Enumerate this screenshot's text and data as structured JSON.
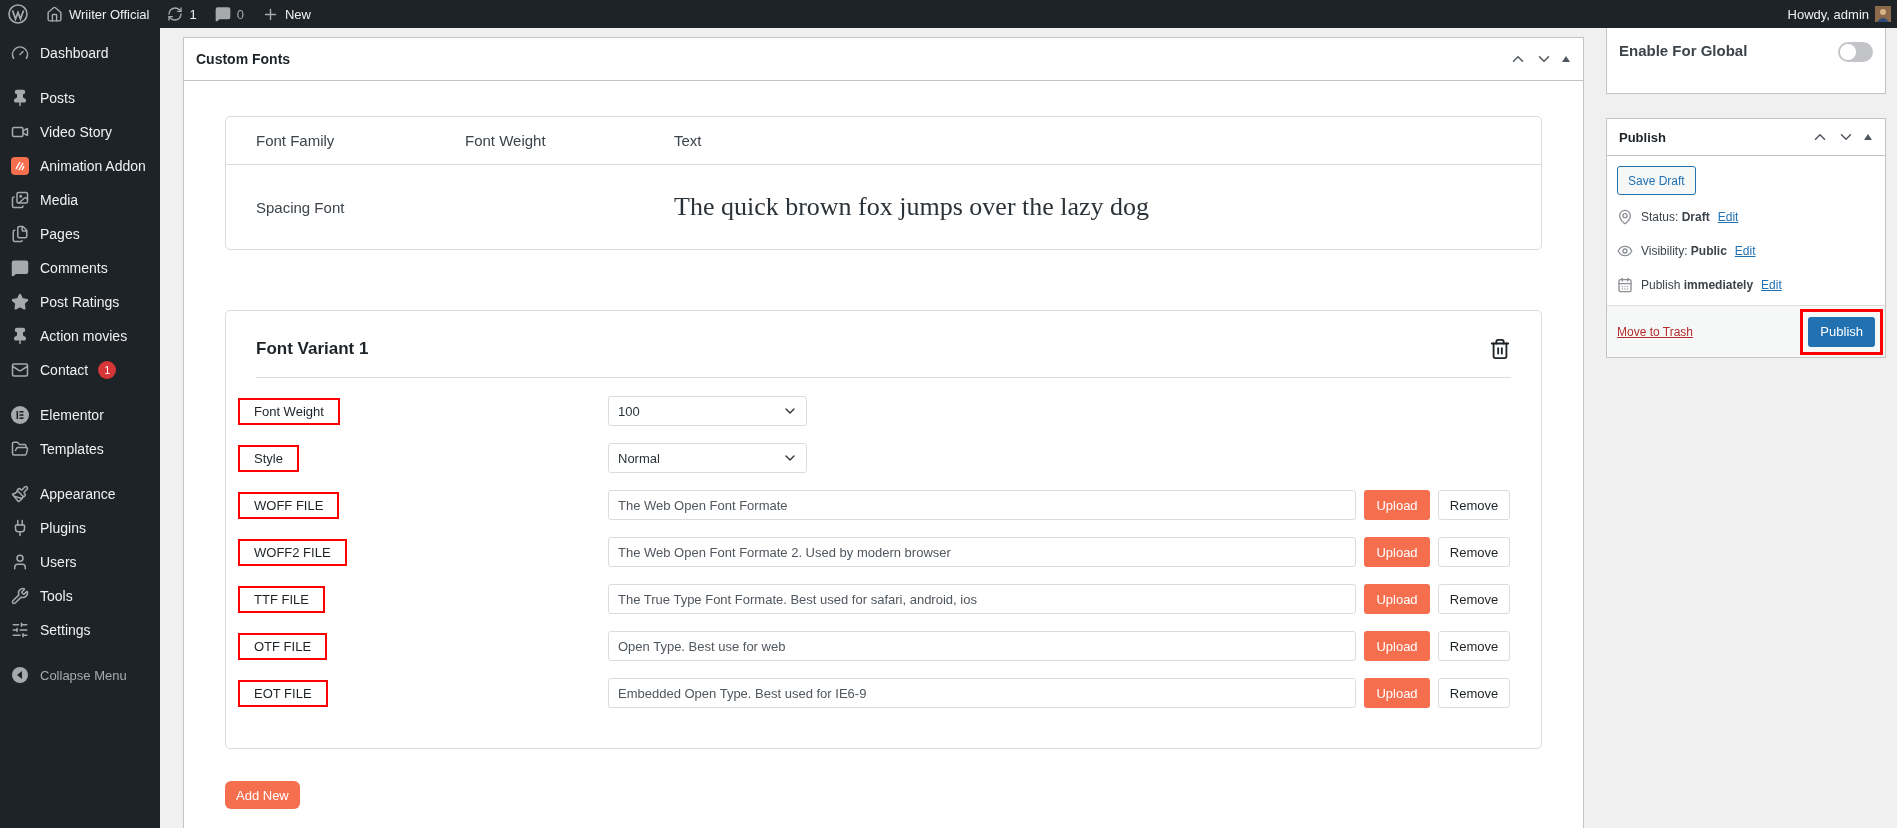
{
  "admin_bar": {
    "site_name": "Wriiter Official",
    "updates": "1",
    "comments": "0",
    "new": "New",
    "greeting": "Howdy, admin"
  },
  "sidebar": {
    "groups": [
      {
        "items": [
          {
            "label": "Dashboard"
          }
        ]
      },
      {
        "items": [
          {
            "label": "Posts"
          },
          {
            "label": "Video Story"
          },
          {
            "label": "Animation Addon"
          },
          {
            "label": "Media"
          },
          {
            "label": "Pages"
          },
          {
            "label": "Comments"
          },
          {
            "label": "Post Ratings"
          },
          {
            "label": "Action movies"
          },
          {
            "label": "Contact",
            "badge": "1"
          }
        ]
      },
      {
        "items": [
          {
            "label": "Elementor"
          },
          {
            "label": "Templates"
          }
        ]
      },
      {
        "items": [
          {
            "label": "Appearance"
          },
          {
            "label": "Plugins"
          },
          {
            "label": "Users"
          },
          {
            "label": "Tools"
          },
          {
            "label": "Settings"
          }
        ]
      }
    ],
    "collapse": "Collapse Menu"
  },
  "main_panel": {
    "title": "Custom Fonts",
    "preview": {
      "columns": [
        "Font Family",
        "Font Weight",
        "Text"
      ],
      "font_family": "Spacing Font",
      "sample_text": "The quick brown fox jumps over the lazy dog"
    },
    "variant": {
      "title": "Font Variant 1",
      "fields": [
        {
          "kind": "select",
          "label": "Font Weight",
          "value": "100",
          "highlighted": true
        },
        {
          "kind": "select",
          "label": "Style",
          "value": "Normal",
          "highlighted": true
        },
        {
          "kind": "file",
          "label": "WOFF FILE",
          "placeholder": "The Web Open Font Formate",
          "upload": "Upload",
          "remove": "Remove",
          "highlighted": true
        },
        {
          "kind": "file",
          "label": "WOFF2 FILE",
          "placeholder": "The Web Open Font Formate 2. Used by modern browser",
          "upload": "Upload",
          "remove": "Remove",
          "highlighted": true
        },
        {
          "kind": "file",
          "label": "TTF FILE",
          "placeholder": "The True Type Font Formate. Best used for safari, android, ios",
          "upload": "Upload",
          "remove": "Remove",
          "highlighted": true
        },
        {
          "kind": "file",
          "label": "OTF FILE",
          "placeholder": "Open Type. Best use for web",
          "upload": "Upload",
          "remove": "Remove",
          "highlighted": true
        },
        {
          "kind": "file",
          "label": "EOT FILE",
          "placeholder": "Embedded Open Type. Best used for IE6-9",
          "upload": "Upload",
          "remove": "Remove",
          "highlighted": true
        }
      ]
    },
    "add_new": "Add New"
  },
  "global": {
    "label": "Enable For Global",
    "on": false
  },
  "publish": {
    "title": "Publish",
    "save_draft": "Save Draft",
    "meta": [
      {
        "text": "Status: **Draft**",
        "link": "Edit"
      },
      {
        "text": "Visibility: **Public**",
        "link": "Edit"
      },
      {
        "text": "Publish **immediately**",
        "link": "Edit"
      }
    ],
    "trash": "Move to Trash",
    "button": "Publish",
    "button_highlighted": true
  }
}
